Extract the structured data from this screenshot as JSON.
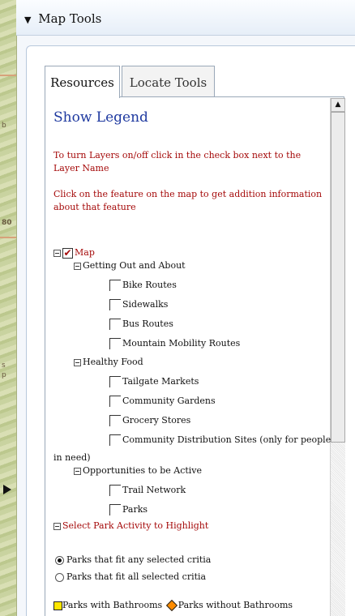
{
  "header": {
    "title": "Map Tools",
    "toggle_icon": "triangle-down-icon"
  },
  "map_strip": {
    "labels": [
      "b",
      "80",
      "s",
      "p"
    ]
  },
  "tabs": [
    {
      "label": "Resources",
      "active": true
    },
    {
      "label": "Locate Tools",
      "active": false
    }
  ],
  "resources": {
    "show_legend": "Show Legend",
    "instructions": [
      "To turn Layers on/off click in the check box next to the Layer Name",
      "Click on the feature on the map to get addition information about that feature"
    ],
    "tree": {
      "root": {
        "label": "Map",
        "checked": true
      },
      "groups": [
        {
          "label": "Getting Out and About",
          "items": [
            "Bike Routes",
            "Sidewalks",
            "Bus Routes",
            "Mountain Mobility Routes"
          ]
        },
        {
          "label": "Healthy Food",
          "items": [
            "Tailgate Markets",
            "Community Gardens",
            "Grocery Stores",
            "Community Distribution Sites (only for people",
            "in need)"
          ]
        },
        {
          "label": "Opportunities to be Active",
          "items": [
            "Trail Network",
            "Parks"
          ]
        }
      ]
    },
    "park_highlight": {
      "label": "Select Park Activity to Highlight",
      "options": [
        {
          "label": "Parks that fit any selected critia",
          "selected": true
        },
        {
          "label": "Parks that fit all selected critia",
          "selected": false
        }
      ],
      "legend": [
        {
          "label": "Parks with Bathrooms",
          "color": "#ffe600"
        },
        {
          "label": "Parks without Bathrooms",
          "color": "#ff8c00"
        }
      ]
    }
  },
  "colors": {
    "link": "#1f3aa0",
    "instruction_red": "#a50a0a",
    "header_bg": "#e6eef8"
  }
}
